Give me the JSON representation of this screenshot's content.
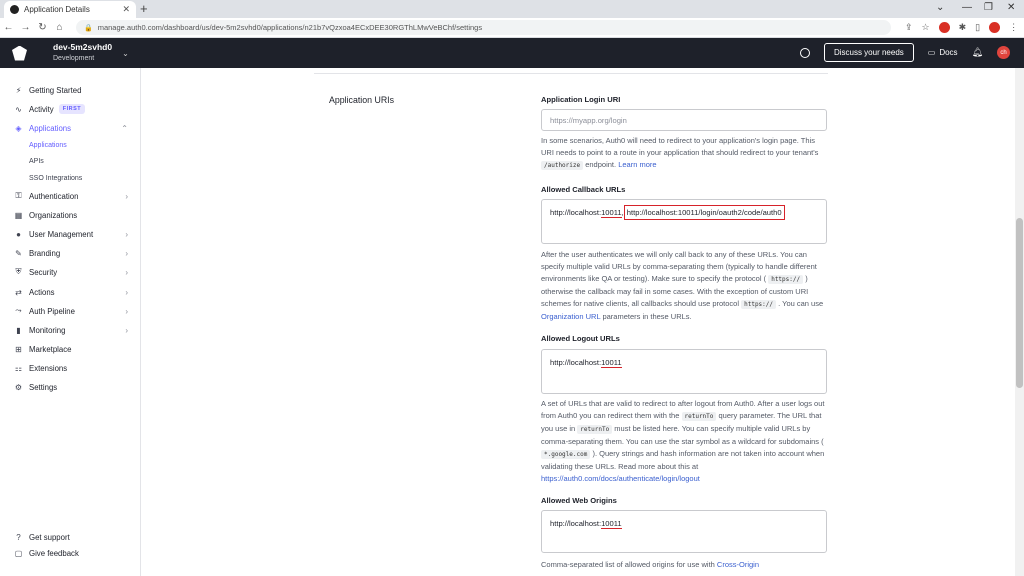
{
  "browser": {
    "tab_title": "Application Details",
    "url": "manage.auth0.com/dashboard/us/dev-5m2svhd0/applications/n21b7vQzxoa4ECxDEE30RGThLMwVeBChf/settings"
  },
  "header": {
    "tenant_name": "dev-5m2svhd0",
    "tenant_env": "Development",
    "discuss_label": "Discuss your needs",
    "docs_label": "Docs",
    "avatar_text": "ch"
  },
  "sidebar": {
    "items": [
      {
        "label": "Getting Started",
        "icon": "bolt-icon"
      },
      {
        "label": "Activity",
        "icon": "activity-icon",
        "badge": "FIRST"
      },
      {
        "label": "Applications",
        "icon": "layers-icon"
      },
      {
        "label": "Authentication",
        "icon": "key-icon"
      },
      {
        "label": "Organizations",
        "icon": "building-icon"
      },
      {
        "label": "User Management",
        "icon": "user-icon"
      },
      {
        "label": "Branding",
        "icon": "brush-icon"
      },
      {
        "label": "Security",
        "icon": "shield-icon"
      },
      {
        "label": "Actions",
        "icon": "actions-icon"
      },
      {
        "label": "Auth Pipeline",
        "icon": "pipeline-icon"
      },
      {
        "label": "Monitoring",
        "icon": "chart-icon"
      },
      {
        "label": "Marketplace",
        "icon": "grid-icon"
      },
      {
        "label": "Extensions",
        "icon": "extensions-icon"
      },
      {
        "label": "Settings",
        "icon": "gear-icon"
      }
    ],
    "sub_items": [
      "Applications",
      "APIs",
      "SSO Integrations"
    ],
    "footer": [
      "Get support",
      "Give feedback"
    ]
  },
  "main": {
    "section_title": "Application URIs",
    "login_uri": {
      "label": "Application Login URI",
      "placeholder": "https://myapp.org/login",
      "help_1": "In some scenarios, Auth0 will need to redirect to your application's login page. This URI needs to point to a route in your application that should redirect to your tenant's",
      "help_code": "/authorize",
      "help_2": "endpoint.",
      "help_link": "Learn more"
    },
    "callback": {
      "label": "Allowed Callback URLs",
      "value_a": "http://localhost:",
      "value_a_port": "10011",
      "value_sep": ",",
      "value_b": "http://localhost:10011/login/oauth2/code/auth0",
      "help_1": "After the user authenticates we will only call back to any of these URLs. You can specify multiple valid URLs by comma-separating them (typically to handle different environments like QA or testing). Make sure to specify the protocol (",
      "help_code1": "https://",
      "help_2": ") otherwise the callback may fail in some cases. With the exception of custom URI schemes for native clients, all callbacks should use protocol",
      "help_code2": "https://",
      "help_3": ". You can use",
      "help_link": "Organization URL",
      "help_4": "parameters in these URLs."
    },
    "logout": {
      "label": "Allowed Logout URLs",
      "value_a": "http://localhost:",
      "value_a_port": "10011",
      "help_1": "A set of URLs that are valid to redirect to after logout from Auth0. After a user logs out from Auth0 you can redirect them with the",
      "help_code1": "returnTo",
      "help_2": "query parameter. The URL that you use in",
      "help_code2": "returnTo",
      "help_3": "must be listed here. You can specify multiple valid URLs by comma-separating them. You can use the star symbol as a wildcard for subdomains (",
      "help_code3": "*.google.com",
      "help_4": "). Query strings and hash information are not taken into account when validating these URLs. Read more about this at",
      "help_link": "https://auth0.com/docs/authenticate/login/logout"
    },
    "web_origins": {
      "label": "Allowed Web Origins",
      "value_a": "http://localhost:",
      "value_a_port": "10011",
      "help_1": "Comma-separated list of allowed origins for use with",
      "help_link": "Cross-Origin"
    }
  }
}
